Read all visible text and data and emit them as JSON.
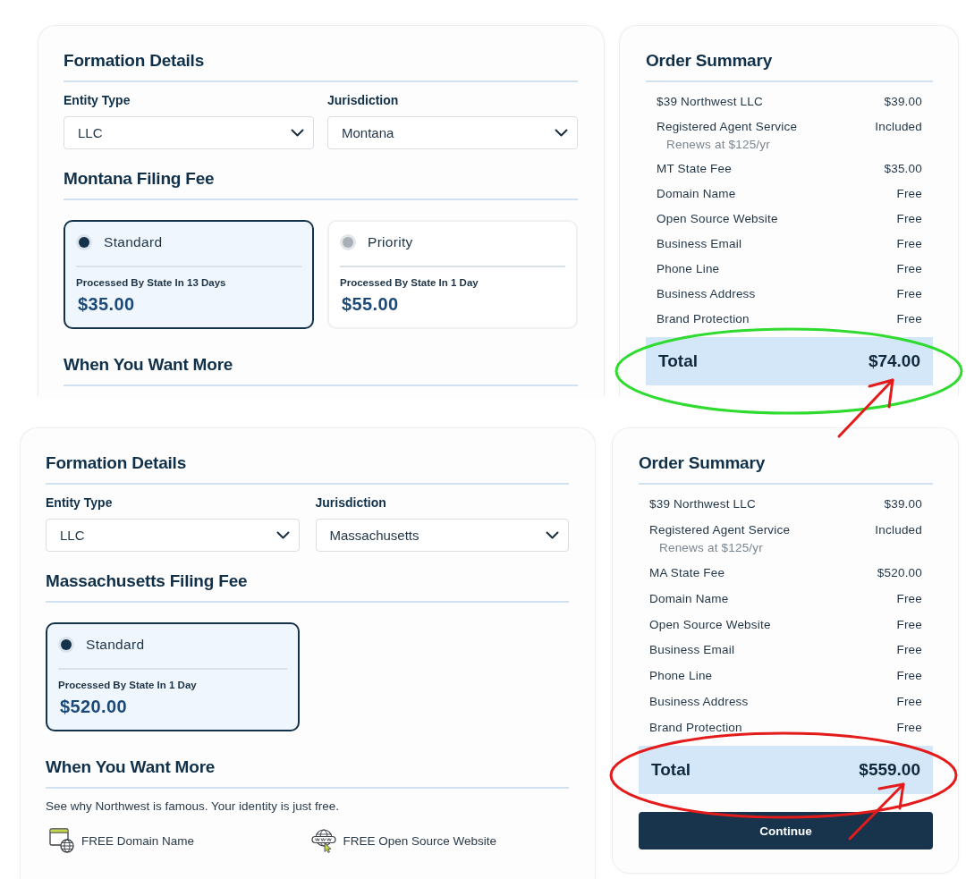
{
  "screens": [
    {
      "formation": {
        "title": "Formation Details",
        "fields": [
          {
            "label": "Entity Type",
            "value": "LLC"
          },
          {
            "label": "Jurisdiction",
            "value": "Montana"
          }
        ],
        "fee_title": "Montana Filing Fee",
        "fee_options": [
          {
            "name": "Standard",
            "selected": true,
            "detail": "Processed By State In 13 Days",
            "price": "$35.00"
          },
          {
            "name": "Priority",
            "selected": false,
            "detail": "Processed By State In 1 Day",
            "price": "$55.00"
          }
        ],
        "more": {
          "title": "When You Want More"
        }
      },
      "summary": {
        "title": "Order Summary",
        "items": [
          {
            "label": "$39 Northwest LLC",
            "amount": "$39.00"
          },
          {
            "label": "Registered Agent Service",
            "note": "Renews at $125/yr",
            "amount": "Included"
          },
          {
            "label": "MT State Fee",
            "amount": "$35.00"
          },
          {
            "label": "Domain Name",
            "amount": "Free"
          },
          {
            "label": "Open Source Website",
            "amount": "Free"
          },
          {
            "label": "Business Email",
            "amount": "Free"
          },
          {
            "label": "Phone Line",
            "amount": "Free"
          },
          {
            "label": "Business Address",
            "amount": "Free"
          },
          {
            "label": "Brand Protection",
            "amount": "Free"
          }
        ],
        "total_label": "Total",
        "total": "$74.00",
        "highlight": {
          "color": "#2edb2e"
        }
      }
    },
    {
      "formation": {
        "title": "Formation Details",
        "fields": [
          {
            "label": "Entity Type",
            "value": "LLC"
          },
          {
            "label": "Jurisdiction",
            "value": "Massachusetts"
          }
        ],
        "fee_title": "Massachusetts Filing Fee",
        "fee_options": [
          {
            "name": "Standard",
            "selected": true,
            "detail": "Processed By State In 1 Day",
            "price": "$520.00"
          }
        ],
        "more": {
          "title": "When You Want More",
          "text": "See why Northwest is famous. Your identity is just free.",
          "features": [
            {
              "kind": "domain",
              "label": "FREE Domain Name"
            },
            {
              "kind": "website",
              "label": "FREE Open Source Website"
            }
          ]
        }
      },
      "summary": {
        "title": "Order Summary",
        "items": [
          {
            "label": "$39 Northwest LLC",
            "amount": "$39.00"
          },
          {
            "label": "Registered Agent Service",
            "note": "Renews at $125/yr",
            "amount": "Included"
          },
          {
            "label": "MA State Fee",
            "amount": "$520.00"
          },
          {
            "label": "Domain Name",
            "amount": "Free"
          },
          {
            "label": "Open Source Website",
            "amount": "Free"
          },
          {
            "label": "Business Email",
            "amount": "Free"
          },
          {
            "label": "Phone Line",
            "amount": "Free"
          },
          {
            "label": "Business Address",
            "amount": "Free"
          },
          {
            "label": "Brand Protection",
            "amount": "Free"
          }
        ],
        "total_label": "Total",
        "total": "$559.00",
        "button": "Continue",
        "highlight": {
          "color": "#e31b1b"
        }
      }
    }
  ]
}
